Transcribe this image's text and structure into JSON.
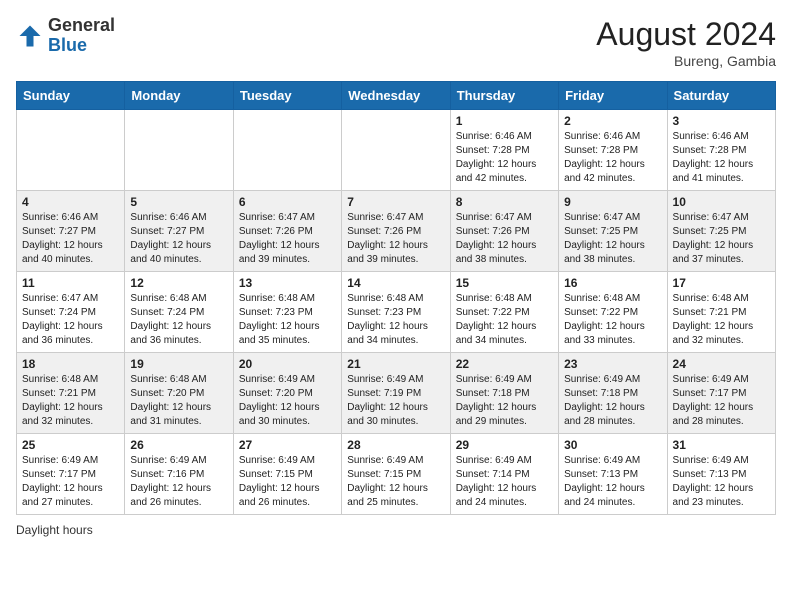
{
  "header": {
    "logo_general": "General",
    "logo_blue": "Blue",
    "month_year": "August 2024",
    "location": "Bureng, Gambia"
  },
  "days_of_week": [
    "Sunday",
    "Monday",
    "Tuesday",
    "Wednesday",
    "Thursday",
    "Friday",
    "Saturday"
  ],
  "weeks": [
    [
      {
        "day": "",
        "info": ""
      },
      {
        "day": "",
        "info": ""
      },
      {
        "day": "",
        "info": ""
      },
      {
        "day": "",
        "info": ""
      },
      {
        "day": "1",
        "info": "Sunrise: 6:46 AM\nSunset: 7:28 PM\nDaylight: 12 hours\nand 42 minutes."
      },
      {
        "day": "2",
        "info": "Sunrise: 6:46 AM\nSunset: 7:28 PM\nDaylight: 12 hours\nand 42 minutes."
      },
      {
        "day": "3",
        "info": "Sunrise: 6:46 AM\nSunset: 7:28 PM\nDaylight: 12 hours\nand 41 minutes."
      }
    ],
    [
      {
        "day": "4",
        "info": "Sunrise: 6:46 AM\nSunset: 7:27 PM\nDaylight: 12 hours\nand 40 minutes."
      },
      {
        "day": "5",
        "info": "Sunrise: 6:46 AM\nSunset: 7:27 PM\nDaylight: 12 hours\nand 40 minutes."
      },
      {
        "day": "6",
        "info": "Sunrise: 6:47 AM\nSunset: 7:26 PM\nDaylight: 12 hours\nand 39 minutes."
      },
      {
        "day": "7",
        "info": "Sunrise: 6:47 AM\nSunset: 7:26 PM\nDaylight: 12 hours\nand 39 minutes."
      },
      {
        "day": "8",
        "info": "Sunrise: 6:47 AM\nSunset: 7:26 PM\nDaylight: 12 hours\nand 38 minutes."
      },
      {
        "day": "9",
        "info": "Sunrise: 6:47 AM\nSunset: 7:25 PM\nDaylight: 12 hours\nand 38 minutes."
      },
      {
        "day": "10",
        "info": "Sunrise: 6:47 AM\nSunset: 7:25 PM\nDaylight: 12 hours\nand 37 minutes."
      }
    ],
    [
      {
        "day": "11",
        "info": "Sunrise: 6:47 AM\nSunset: 7:24 PM\nDaylight: 12 hours\nand 36 minutes."
      },
      {
        "day": "12",
        "info": "Sunrise: 6:48 AM\nSunset: 7:24 PM\nDaylight: 12 hours\nand 36 minutes."
      },
      {
        "day": "13",
        "info": "Sunrise: 6:48 AM\nSunset: 7:23 PM\nDaylight: 12 hours\nand 35 minutes."
      },
      {
        "day": "14",
        "info": "Sunrise: 6:48 AM\nSunset: 7:23 PM\nDaylight: 12 hours\nand 34 minutes."
      },
      {
        "day": "15",
        "info": "Sunrise: 6:48 AM\nSunset: 7:22 PM\nDaylight: 12 hours\nand 34 minutes."
      },
      {
        "day": "16",
        "info": "Sunrise: 6:48 AM\nSunset: 7:22 PM\nDaylight: 12 hours\nand 33 minutes."
      },
      {
        "day": "17",
        "info": "Sunrise: 6:48 AM\nSunset: 7:21 PM\nDaylight: 12 hours\nand 32 minutes."
      }
    ],
    [
      {
        "day": "18",
        "info": "Sunrise: 6:48 AM\nSunset: 7:21 PM\nDaylight: 12 hours\nand 32 minutes."
      },
      {
        "day": "19",
        "info": "Sunrise: 6:48 AM\nSunset: 7:20 PM\nDaylight: 12 hours\nand 31 minutes."
      },
      {
        "day": "20",
        "info": "Sunrise: 6:49 AM\nSunset: 7:20 PM\nDaylight: 12 hours\nand 30 minutes."
      },
      {
        "day": "21",
        "info": "Sunrise: 6:49 AM\nSunset: 7:19 PM\nDaylight: 12 hours\nand 30 minutes."
      },
      {
        "day": "22",
        "info": "Sunrise: 6:49 AM\nSunset: 7:18 PM\nDaylight: 12 hours\nand 29 minutes."
      },
      {
        "day": "23",
        "info": "Sunrise: 6:49 AM\nSunset: 7:18 PM\nDaylight: 12 hours\nand 28 minutes."
      },
      {
        "day": "24",
        "info": "Sunrise: 6:49 AM\nSunset: 7:17 PM\nDaylight: 12 hours\nand 28 minutes."
      }
    ],
    [
      {
        "day": "25",
        "info": "Sunrise: 6:49 AM\nSunset: 7:17 PM\nDaylight: 12 hours\nand 27 minutes."
      },
      {
        "day": "26",
        "info": "Sunrise: 6:49 AM\nSunset: 7:16 PM\nDaylight: 12 hours\nand 26 minutes."
      },
      {
        "day": "27",
        "info": "Sunrise: 6:49 AM\nSunset: 7:15 PM\nDaylight: 12 hours\nand 26 minutes."
      },
      {
        "day": "28",
        "info": "Sunrise: 6:49 AM\nSunset: 7:15 PM\nDaylight: 12 hours\nand 25 minutes."
      },
      {
        "day": "29",
        "info": "Sunrise: 6:49 AM\nSunset: 7:14 PM\nDaylight: 12 hours\nand 24 minutes."
      },
      {
        "day": "30",
        "info": "Sunrise: 6:49 AM\nSunset: 7:13 PM\nDaylight: 12 hours\nand 24 minutes."
      },
      {
        "day": "31",
        "info": "Sunrise: 6:49 AM\nSunset: 7:13 PM\nDaylight: 12 hours\nand 23 minutes."
      }
    ]
  ],
  "footer": {
    "daylight_hours_label": "Daylight hours"
  }
}
